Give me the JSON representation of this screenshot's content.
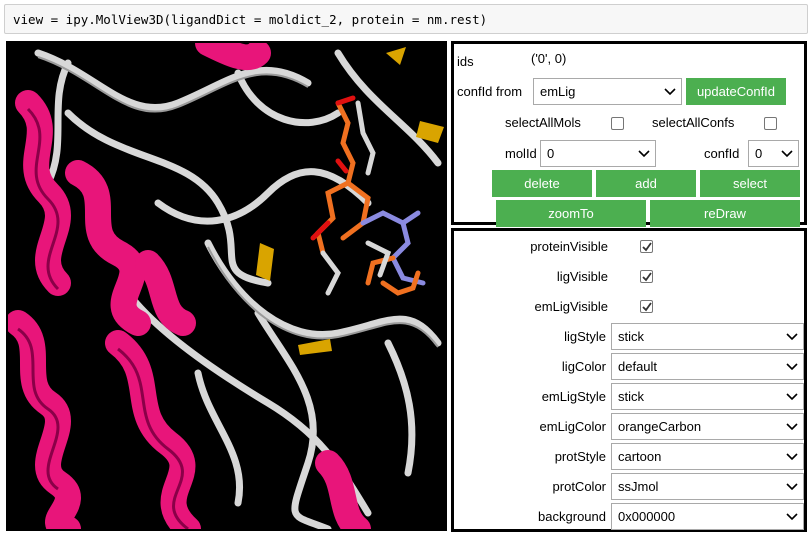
{
  "code_cell": {
    "text": "view = ipy.MolView3D(ligandDict = moldict_2, protein = nm.rest)"
  },
  "controls": {
    "ids": {
      "label": "ids",
      "value": "('0', 0)"
    },
    "confid_from": {
      "label": "confId from",
      "value": "emLig"
    },
    "update_button": "updateConfId",
    "select_all_mols": {
      "label": "selectAllMols",
      "checked": false
    },
    "select_all_confs": {
      "label": "selectAllConfs",
      "checked": false
    },
    "mol_id": {
      "label": "molId",
      "value": "0"
    },
    "conf_id": {
      "label": "confId",
      "value": "0"
    },
    "buttons": {
      "delete": "delete",
      "add": "add",
      "select": "select",
      "zoom_to": "zoomTo",
      "redraw": "reDraw"
    }
  },
  "settings": {
    "protein_visible": {
      "label": "proteinVisible",
      "checked": true
    },
    "lig_visible": {
      "label": "ligVisible",
      "checked": true
    },
    "em_lig_visible": {
      "label": "emLigVisible",
      "checked": true
    },
    "lig_style": {
      "label": "ligStyle",
      "value": "stick"
    },
    "lig_color": {
      "label": "ligColor",
      "value": "default"
    },
    "em_lig_style": {
      "label": "emLigStyle",
      "value": "stick"
    },
    "em_lig_color": {
      "label": "emLigColor",
      "value": "orangeCarbon"
    },
    "prot_style": {
      "label": "protStyle",
      "value": "cartoon"
    },
    "prot_color": {
      "label": "protColor",
      "value": "ssJmol"
    },
    "background": {
      "label": "background",
      "value": "0x000000"
    }
  },
  "colors": {
    "accent_button": "#4caf50",
    "helix": "#e8157a",
    "coil": "#d8d8d8",
    "sheet": "#d9a400",
    "ligand_carbon": "#f07020",
    "ligand_nitrogen": "#8a8ae0",
    "ligand_oxygen": "#e01010"
  }
}
